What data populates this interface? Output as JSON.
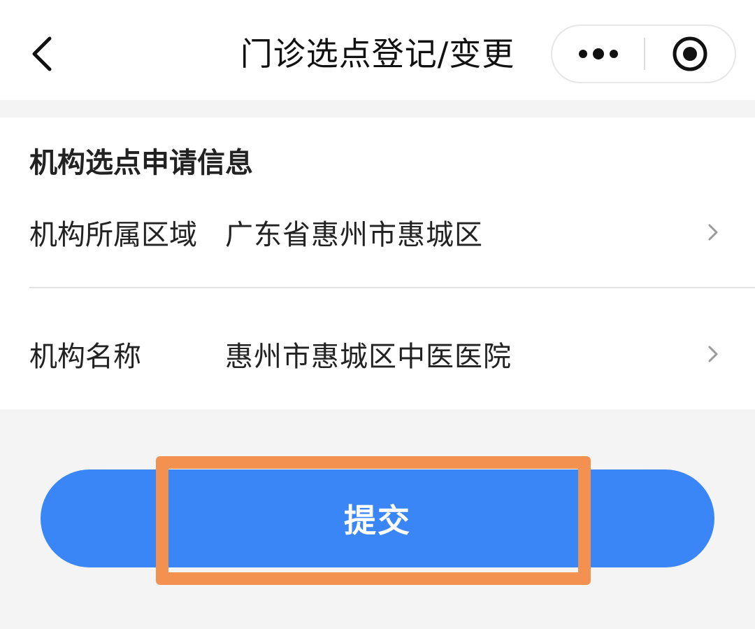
{
  "navbar": {
    "back_icon": "chevron-left-icon",
    "title": "门诊选点登记/变更",
    "more_icon": "more-dots-icon",
    "close_icon": "target-circle-icon"
  },
  "card": {
    "section_title": "机构选点申请信息",
    "rows": [
      {
        "label": "机构所属区域",
        "value": "广东省惠州市惠城区",
        "icon": "chevron-right-icon"
      },
      {
        "label": "机构名称",
        "value": "惠州市惠城区中医医院",
        "icon": "chevron-right-icon"
      }
    ]
  },
  "submit": {
    "label": "提交",
    "color": "#3a86f7",
    "highlight_color": "#f39150"
  }
}
